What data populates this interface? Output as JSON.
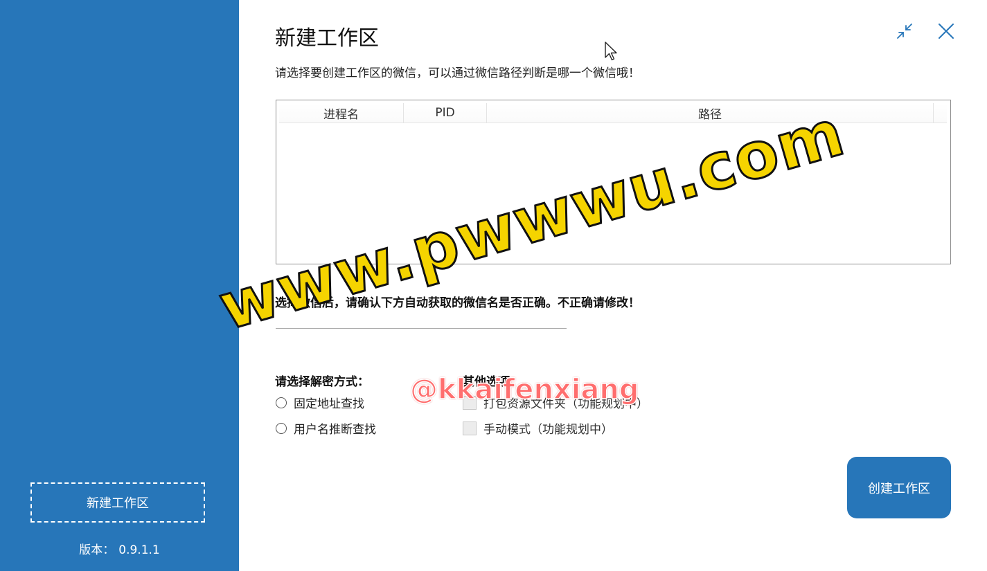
{
  "sidebar": {
    "new_workspace_label": "新建工作区",
    "version_label": "版本：",
    "version_value": "0.9.1.1"
  },
  "header": {
    "title": "新建工作区",
    "subtitle": "请选择要创建工作区的微信，可以通过微信路径判断是哪一个微信哦！"
  },
  "process_table": {
    "columns": [
      "进程名",
      "PID",
      "路径"
    ],
    "rows": []
  },
  "wechat_name": {
    "notice": "选择微信后，请确认下方自动获取的微信名是否正确。不正确请修改！",
    "value": ""
  },
  "decrypt": {
    "label": "请选择解密方式：",
    "options": [
      "固定地址查找",
      "用户名推断查找"
    ]
  },
  "other": {
    "label": "其他选项：",
    "options": [
      "打包资源文件夹（功能规划中）",
      "手动模式（功能规划中）"
    ]
  },
  "actions": {
    "create_label": "创建工作区"
  },
  "watermark": {
    "url": "www.pwwwu.com",
    "handle": "@kkaifenxiang"
  },
  "colors": {
    "accent": "#2776b9",
    "watermark_yellow": "#f5d400",
    "watermark_red": "#ff6e6e"
  },
  "icons": {
    "collapse": "collapse-arrows-icon",
    "close": "close-icon",
    "cursor": "mouse-cursor-icon"
  }
}
